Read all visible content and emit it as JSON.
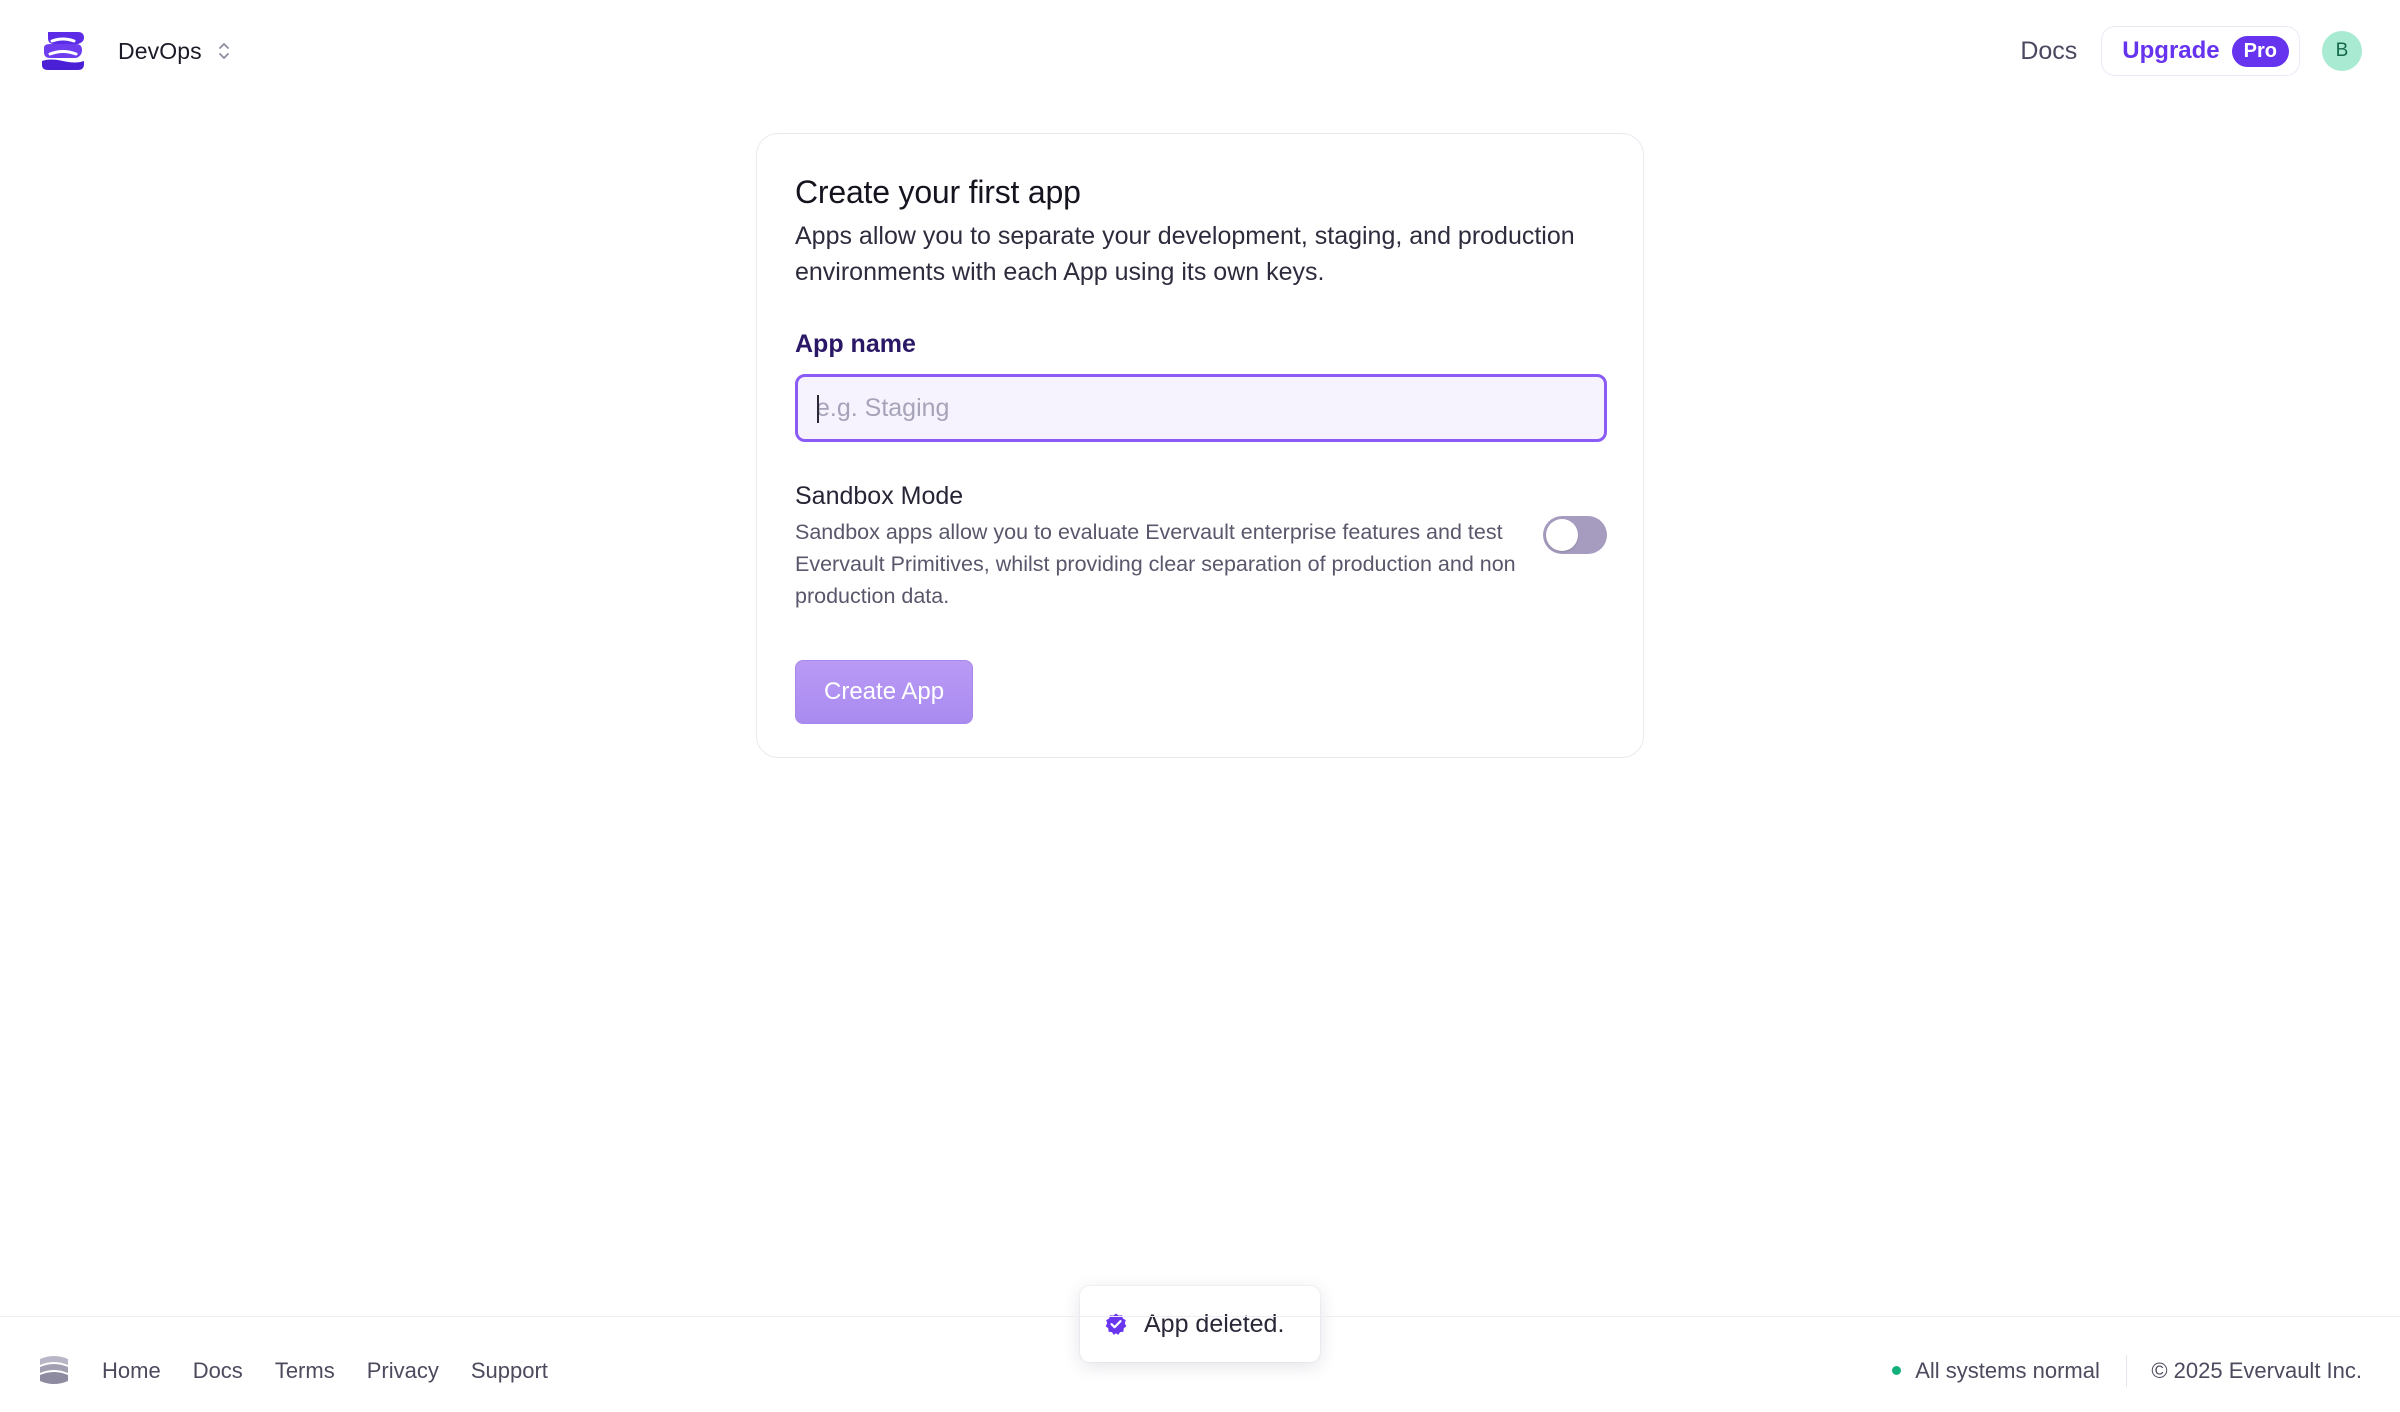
{
  "header": {
    "org_name": "DevOps",
    "docs_label": "Docs",
    "upgrade_label": "Upgrade",
    "pro_badge": "Pro",
    "avatar_initial": "B",
    "logo_icon": "evervault-logo-icon",
    "org_switch_icon": "chevron-up-down-icon"
  },
  "card": {
    "title": "Create your first app",
    "description": "Apps allow you to separate your development, staging, and production environments with each App using its own keys.",
    "app_name_label": "App name",
    "app_name_value": "",
    "app_name_placeholder": "e.g. Staging",
    "sandbox_title": "Sandbox Mode",
    "sandbox_description": "Sandbox apps allow you to evaluate Evervault enterprise features and test Evervault Primitives, whilst providing clear separation of production and non production data.",
    "sandbox_enabled": false,
    "create_button": "Create App"
  },
  "toast": {
    "message": "App deleted.",
    "icon": "check-badge-icon"
  },
  "footer": {
    "links": [
      "Home",
      "Docs",
      "Terms",
      "Privacy",
      "Support"
    ],
    "status": "All systems normal",
    "copyright": "© 2025 Evervault Inc."
  },
  "colors": {
    "brand": "#6633ee",
    "input_focus_border": "#8a5cf5",
    "input_bg": "#f6f3ff",
    "button_disabled": "#b99af5",
    "toggle_off": "#a69cbf",
    "avatar_bg": "#a9ead2",
    "status_ok": "#13b07a"
  }
}
